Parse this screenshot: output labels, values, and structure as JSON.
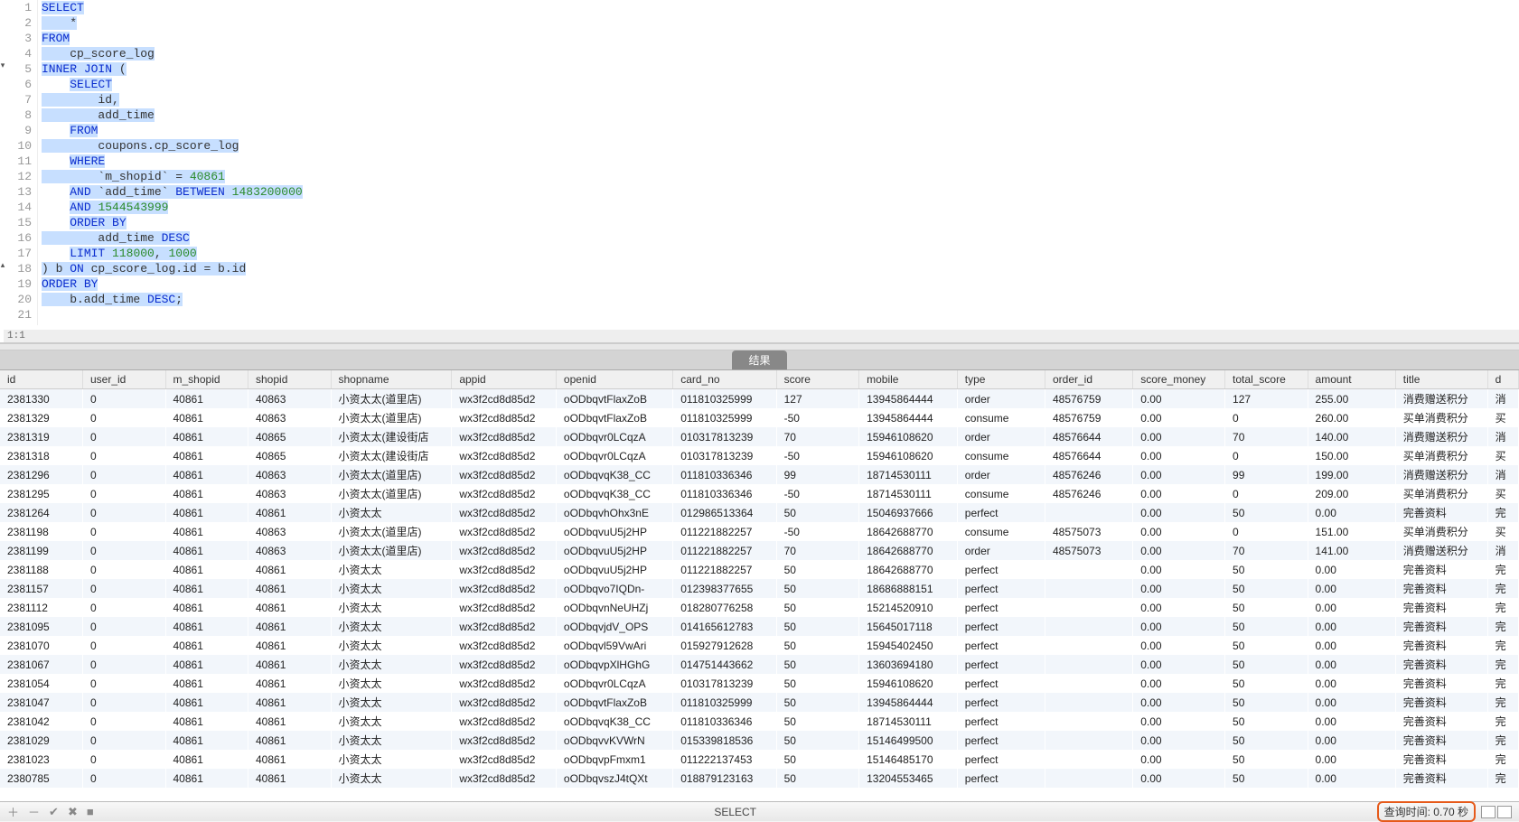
{
  "editor": {
    "cursor": "1:1",
    "lines": [
      {
        "n": 1,
        "tokens": [
          {
            "t": "SELECT",
            "c": "kw"
          }
        ]
      },
      {
        "n": 2,
        "tokens": [
          {
            "t": "    *",
            "c": "txt"
          }
        ]
      },
      {
        "n": 3,
        "tokens": [
          {
            "t": "FROM",
            "c": "kw"
          }
        ]
      },
      {
        "n": 4,
        "tokens": [
          {
            "t": "    cp_score_log",
            "c": "txt"
          }
        ]
      },
      {
        "n": 5,
        "fold": "down",
        "tokens": [
          {
            "t": "INNER",
            "c": "kw"
          },
          {
            "t": " ",
            "c": "txt"
          },
          {
            "t": "JOIN",
            "c": "kw"
          },
          {
            "t": " (",
            "c": "txt"
          }
        ]
      },
      {
        "n": 6,
        "tokens": [
          {
            "t": "    ",
            "c": "plain"
          },
          {
            "t": "SELECT",
            "c": "kw"
          }
        ]
      },
      {
        "n": 7,
        "tokens": [
          {
            "t": "        id,",
            "c": "txt"
          }
        ]
      },
      {
        "n": 8,
        "tokens": [
          {
            "t": "        add_time",
            "c": "txt"
          }
        ]
      },
      {
        "n": 9,
        "tokens": [
          {
            "t": "    ",
            "c": "plain"
          },
          {
            "t": "FROM",
            "c": "kw"
          }
        ]
      },
      {
        "n": 10,
        "tokens": [
          {
            "t": "        coupons.cp_score_log",
            "c": "txt"
          }
        ]
      },
      {
        "n": 11,
        "tokens": [
          {
            "t": "    ",
            "c": "plain"
          },
          {
            "t": "WHERE",
            "c": "kw"
          }
        ]
      },
      {
        "n": 12,
        "tokens": [
          {
            "t": "        `m_shopid` = ",
            "c": "txt"
          },
          {
            "t": "40861",
            "c": "num"
          }
        ]
      },
      {
        "n": 13,
        "tokens": [
          {
            "t": "    ",
            "c": "plain"
          },
          {
            "t": "AND",
            "c": "kw"
          },
          {
            "t": " `add_time` ",
            "c": "txt"
          },
          {
            "t": "BETWEEN",
            "c": "kw"
          },
          {
            "t": " ",
            "c": "txt"
          },
          {
            "t": "1483200000",
            "c": "num"
          }
        ]
      },
      {
        "n": 14,
        "tokens": [
          {
            "t": "    ",
            "c": "plain"
          },
          {
            "t": "AND",
            "c": "kw"
          },
          {
            "t": " ",
            "c": "txt"
          },
          {
            "t": "1544543999",
            "c": "num"
          }
        ]
      },
      {
        "n": 15,
        "tokens": [
          {
            "t": "    ",
            "c": "plain"
          },
          {
            "t": "ORDER",
            "c": "kw"
          },
          {
            "t": " ",
            "c": "txt"
          },
          {
            "t": "BY",
            "c": "kw"
          }
        ]
      },
      {
        "n": 16,
        "tokens": [
          {
            "t": "        add_time ",
            "c": "txt"
          },
          {
            "t": "DESC",
            "c": "kw"
          }
        ]
      },
      {
        "n": 17,
        "tokens": [
          {
            "t": "    ",
            "c": "plain"
          },
          {
            "t": "LIMIT",
            "c": "kw"
          },
          {
            "t": " ",
            "c": "txt"
          },
          {
            "t": "118000",
            "c": "num"
          },
          {
            "t": ", ",
            "c": "txt"
          },
          {
            "t": "1000",
            "c": "num"
          }
        ]
      },
      {
        "n": 18,
        "fold": "up",
        "tokens": [
          {
            "t": ") b ",
            "c": "txt"
          },
          {
            "t": "ON",
            "c": "kw"
          },
          {
            "t": " cp_score_log.id = b.id",
            "c": "txt"
          }
        ]
      },
      {
        "n": 19,
        "tokens": [
          {
            "t": "ORDER",
            "c": "kw"
          },
          {
            "t": " ",
            "c": "txt"
          },
          {
            "t": "BY",
            "c": "kw"
          }
        ]
      },
      {
        "n": 20,
        "tokens": [
          {
            "t": "    b.add_time ",
            "c": "txt"
          },
          {
            "t": "DESC",
            "c": "kw"
          },
          {
            "t": ";",
            "c": "txt"
          }
        ]
      },
      {
        "n": 21,
        "tokens": []
      }
    ]
  },
  "results": {
    "tab_label": "结果",
    "columns": [
      "id",
      "user_id",
      "m_shopid",
      "shopid",
      "shopname",
      "appid",
      "openid",
      "card_no",
      "score",
      "mobile",
      "type",
      "order_id",
      "score_money",
      "total_score",
      "amount",
      "title",
      "d"
    ],
    "rows": [
      [
        "2381330",
        "0",
        "40861",
        "40863",
        "小资太太(道里店)",
        "wx3f2cd8d85d2",
        "oODbqvtFlaxZoB",
        "011810325999",
        "127",
        "13945864444",
        "order",
        "48576759",
        "0.00",
        "127",
        "255.00",
        "消费赠送积分",
        "消"
      ],
      [
        "2381329",
        "0",
        "40861",
        "40863",
        "小资太太(道里店)",
        "wx3f2cd8d85d2",
        "oODbqvtFlaxZoB",
        "011810325999",
        "-50",
        "13945864444",
        "consume",
        "48576759",
        "0.00",
        "0",
        "260.00",
        "买单消费积分",
        "买"
      ],
      [
        "2381319",
        "0",
        "40861",
        "40865",
        "小资太太(建设街店",
        "wx3f2cd8d85d2",
        "oODbqvr0LCqzA",
        "010317813239",
        "70",
        "15946108620",
        "order",
        "48576644",
        "0.00",
        "70",
        "140.00",
        "消费赠送积分",
        "消"
      ],
      [
        "2381318",
        "0",
        "40861",
        "40865",
        "小资太太(建设街店",
        "wx3f2cd8d85d2",
        "oODbqvr0LCqzA",
        "010317813239",
        "-50",
        "15946108620",
        "consume",
        "48576644",
        "0.00",
        "0",
        "150.00",
        "买单消费积分",
        "买"
      ],
      [
        "2381296",
        "0",
        "40861",
        "40863",
        "小资太太(道里店)",
        "wx3f2cd8d85d2",
        "oODbqvqK38_CC",
        "011810336346",
        "99",
        "18714530111",
        "order",
        "48576246",
        "0.00",
        "99",
        "199.00",
        "消费赠送积分",
        "消"
      ],
      [
        "2381295",
        "0",
        "40861",
        "40863",
        "小资太太(道里店)",
        "wx3f2cd8d85d2",
        "oODbqvqK38_CC",
        "011810336346",
        "-50",
        "18714530111",
        "consume",
        "48576246",
        "0.00",
        "0",
        "209.00",
        "买单消费积分",
        "买"
      ],
      [
        "2381264",
        "0",
        "40861",
        "40861",
        "小资太太",
        "wx3f2cd8d85d2",
        "oODbqvhOhx3nE",
        "012986513364",
        "50",
        "15046937666",
        "perfect",
        "",
        "0.00",
        "50",
        "0.00",
        "完善资料",
        "完"
      ],
      [
        "2381198",
        "0",
        "40861",
        "40863",
        "小资太太(道里店)",
        "wx3f2cd8d85d2",
        "oODbqvuU5j2HP",
        "011221882257",
        "-50",
        "18642688770",
        "consume",
        "48575073",
        "0.00",
        "0",
        "151.00",
        "买单消费积分",
        "买"
      ],
      [
        "2381199",
        "0",
        "40861",
        "40863",
        "小资太太(道里店)",
        "wx3f2cd8d85d2",
        "oODbqvuU5j2HP",
        "011221882257",
        "70",
        "18642688770",
        "order",
        "48575073",
        "0.00",
        "70",
        "141.00",
        "消费赠送积分",
        "消"
      ],
      [
        "2381188",
        "0",
        "40861",
        "40861",
        "小资太太",
        "wx3f2cd8d85d2",
        "oODbqvuU5j2HP",
        "011221882257",
        "50",
        "18642688770",
        "perfect",
        "",
        "0.00",
        "50",
        "0.00",
        "完善资料",
        "完"
      ],
      [
        "2381157",
        "0",
        "40861",
        "40861",
        "小资太太",
        "wx3f2cd8d85d2",
        "oODbqvo7IQDn-",
        "012398377655",
        "50",
        "18686888151",
        "perfect",
        "",
        "0.00",
        "50",
        "0.00",
        "完善资料",
        "完"
      ],
      [
        "2381112",
        "0",
        "40861",
        "40861",
        "小资太太",
        "wx3f2cd8d85d2",
        "oODbqvnNeUHZj",
        "018280776258",
        "50",
        "15214520910",
        "perfect",
        "",
        "0.00",
        "50",
        "0.00",
        "完善资料",
        "完"
      ],
      [
        "2381095",
        "0",
        "40861",
        "40861",
        "小资太太",
        "wx3f2cd8d85d2",
        "oODbqvjdV_OPS",
        "014165612783",
        "50",
        "15645017118",
        "perfect",
        "",
        "0.00",
        "50",
        "0.00",
        "完善资料",
        "完"
      ],
      [
        "2381070",
        "0",
        "40861",
        "40861",
        "小资太太",
        "wx3f2cd8d85d2",
        "oODbqvl59VwAri",
        "015927912628",
        "50",
        "15945402450",
        "perfect",
        "",
        "0.00",
        "50",
        "0.00",
        "完善资料",
        "完"
      ],
      [
        "2381067",
        "0",
        "40861",
        "40861",
        "小资太太",
        "wx3f2cd8d85d2",
        "oODbqvpXlHGhG",
        "014751443662",
        "50",
        "13603694180",
        "perfect",
        "",
        "0.00",
        "50",
        "0.00",
        "完善资料",
        "完"
      ],
      [
        "2381054",
        "0",
        "40861",
        "40861",
        "小资太太",
        "wx3f2cd8d85d2",
        "oODbqvr0LCqzA",
        "010317813239",
        "50",
        "15946108620",
        "perfect",
        "",
        "0.00",
        "50",
        "0.00",
        "完善资料",
        "完"
      ],
      [
        "2381047",
        "0",
        "40861",
        "40861",
        "小资太太",
        "wx3f2cd8d85d2",
        "oODbqvtFlaxZoB",
        "011810325999",
        "50",
        "13945864444",
        "perfect",
        "",
        "0.00",
        "50",
        "0.00",
        "完善资料",
        "完"
      ],
      [
        "2381042",
        "0",
        "40861",
        "40861",
        "小资太太",
        "wx3f2cd8d85d2",
        "oODbqvqK38_CC",
        "011810336346",
        "50",
        "18714530111",
        "perfect",
        "",
        "0.00",
        "50",
        "0.00",
        "完善资料",
        "完"
      ],
      [
        "2381029",
        "0",
        "40861",
        "40861",
        "小资太太",
        "wx3f2cd8d85d2",
        "oODbqvvKVWrN",
        "015339818536",
        "50",
        "15146499500",
        "perfect",
        "",
        "0.00",
        "50",
        "0.00",
        "完善资料",
        "完"
      ],
      [
        "2381023",
        "0",
        "40861",
        "40861",
        "小资太太",
        "wx3f2cd8d85d2",
        "oODbqvpFmxm1",
        "011222137453",
        "50",
        "15146485170",
        "perfect",
        "",
        "0.00",
        "50",
        "0.00",
        "完善资料",
        "完"
      ],
      [
        "2380785",
        "0",
        "40861",
        "40861",
        "小资太太",
        "wx3f2cd8d85d2",
        "oODbqvszJ4tQXt",
        "018879123163",
        "50",
        "13204553465",
        "perfect",
        "",
        "0.00",
        "50",
        "0.00",
        "完善资料",
        "完"
      ]
    ]
  },
  "status": {
    "mode": "SELECT",
    "query_time": "查询时间: 0.70 秒"
  }
}
